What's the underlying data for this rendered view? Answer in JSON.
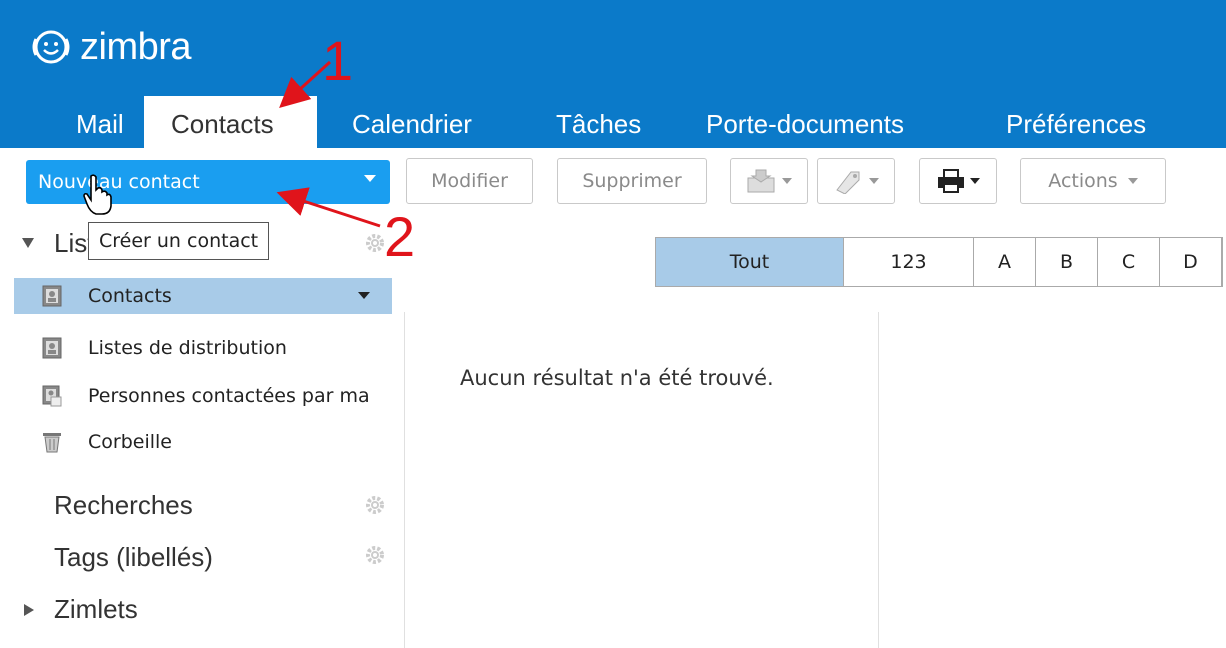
{
  "header": {
    "brand": "zimbra",
    "tabs": [
      {
        "label": "Mail"
      },
      {
        "label": "Contacts"
      },
      {
        "label": "Calendrier"
      },
      {
        "label": "Tâches"
      },
      {
        "label": "Porte-documents"
      },
      {
        "label": "Préférences"
      }
    ],
    "active_tab": "Contacts",
    "background": "#0b7ac9"
  },
  "toolbar": {
    "new_contact_label": "Nouveau contact",
    "modify_label": "Modifier",
    "delete_label": "Supprimer",
    "actions_label": "Actions",
    "tooltip": "Créer un contact"
  },
  "sidebar": {
    "lists_header": "Listes",
    "folders": [
      {
        "label": "Contacts",
        "icon": "contact-book-icon",
        "selected": true
      },
      {
        "label": "Listes de distribution",
        "icon": "contact-book-icon"
      },
      {
        "label": "Personnes contactées par ma",
        "icon": "contacted-people-icon"
      },
      {
        "label": "Corbeille",
        "icon": "trash-icon"
      }
    ],
    "searches": "Recherches",
    "tags": "Tags (libellés)",
    "zimlets": "Zimlets"
  },
  "alphabar": [
    "Tout",
    "123",
    "A",
    "B",
    "C",
    "D"
  ],
  "main": {
    "empty_message": "Aucun résultat n'a été trouvé."
  },
  "annotations": [
    "1",
    "2"
  ],
  "colors": {
    "accent": "#1a9ef0",
    "selection": "#a8cbe8",
    "annotation": "#e0141b"
  }
}
